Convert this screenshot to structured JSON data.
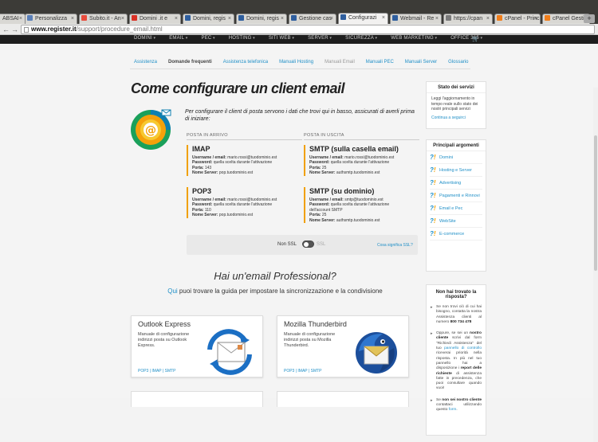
{
  "browser": {
    "tabs": [
      {
        "label": "ABSAI",
        "color": "#2b5fb0"
      },
      {
        "label": "Personalizza",
        "color": "#5a7fb8"
      },
      {
        "label": "Subito.it - An",
        "color": "#e84b3c"
      },
      {
        "label": "Domini .it e",
        "color": "#d93025"
      },
      {
        "label": "Domini, regis",
        "color": "#2e5e9e"
      },
      {
        "label": "Domini, regis",
        "color": "#2e5e9e"
      },
      {
        "label": "Gestione cas",
        "color": "#2e5e9e"
      },
      {
        "label": "Configurazi",
        "color": "#2e5e9e"
      },
      {
        "label": "Webmail - Re",
        "color": "#2e5e9e"
      },
      {
        "label": "https://cpan",
        "color": "#7a7a7a"
      },
      {
        "label": "cPanel - Princ",
        "color": "#f07e1b"
      },
      {
        "label": "cPanel Gesti",
        "color": "#f07e1b"
      }
    ],
    "active_tab": 7,
    "url_host": "www.register.it",
    "url_path": "/support/procedure_email.html"
  },
  "topnav": [
    "DOMINI",
    "EMAIL",
    "PEC",
    "HOSTING",
    "SITI WEB",
    "SERVER",
    "SICUREZZA",
    "WEB MARKETING",
    "OFFICE 365"
  ],
  "subnav": [
    {
      "label": "Assistenza",
      "state": "link"
    },
    {
      "label": "Domande frequenti",
      "state": "current"
    },
    {
      "label": "Assistenza telefonica",
      "state": "link"
    },
    {
      "label": "Manuali Hosting",
      "state": "link"
    },
    {
      "label": "Manuali Email",
      "state": "disabled"
    },
    {
      "label": "Manuali PEC",
      "state": "link"
    },
    {
      "label": "Manuali Server",
      "state": "link"
    },
    {
      "label": "Glossario",
      "state": "link"
    }
  ],
  "main": {
    "title": "Come configurare un client email",
    "intro": "Per configurare il client di posta servono i dati che trovi qui in basso, assicurati di averli prima di iniziare:",
    "col_in": "POSTA IN ARRIVO",
    "col_out": "POSTA IN USCITA",
    "servers": {
      "imap": {
        "title": "IMAP",
        "l1k": "Username / email:",
        "l1v": "mario.rossi@tuodominio.est",
        "l2k": "Password:",
        "l2v": "quella scelta durante l'attivazione",
        "l3k": "Porta:",
        "l3v": "143",
        "l4k": "Nome Server:",
        "l4v": "pop.tuodominio.est"
      },
      "pop3": {
        "title": "POP3",
        "l1k": "Username / email:",
        "l1v": "mario.rossi@tuodominio.est",
        "l2k": "Password:",
        "l2v": "quella scelta durante l'attivazione",
        "l3k": "Porta:",
        "l3v": "110",
        "l4k": "Nome Server:",
        "l4v": "pop.tuodominio.est"
      },
      "smtp1": {
        "title": "SMTP (sulla casella email)",
        "l1k": "Username / email:",
        "l1v": "mario.rossi@tuodominio.est",
        "l2k": "Password:",
        "l2v": "quella scelta durante l'attivazione",
        "l3k": "Porta:",
        "l3v": "25",
        "l4k": "Nome Server:",
        "l4v": "authsmtp.tuodominio.est"
      },
      "smtp2": {
        "title": "SMTP (su dominio)",
        "l1k": "Username / email:",
        "l1v": "smtp@tuodominio.est",
        "l2k": "Password:",
        "l2v": "quella scelta durante l'attivazione",
        "l2b": "dell'account SMTP",
        "l3k": "Porta:",
        "l3v": "25",
        "l4k": "Nome Server:",
        "l4v": "authsmtp.tuodominio.est"
      }
    },
    "ssl": {
      "off": "Non SSL",
      "on": "SSL",
      "link": "Cosa significa SSL?"
    },
    "pro_title": "Hai un'email Professional?",
    "pro_sub_link": "Qui",
    "pro_sub_rest": " puoi trovare la guida per impostare la sincronizzazione e la condivisione",
    "cards": [
      {
        "title": "Outlook Express",
        "desc": "Manuale di configurazione indirizzi posta su Outlook Express.",
        "links": "POP3 | IMAP | SMTP"
      },
      {
        "title": "Mozilla Thunderbird",
        "desc": "Manuale di configurazione indirizzi posta su Mozilla Thunderbird.",
        "links": "POP3 | IMAP | SMTP"
      }
    ]
  },
  "sidebar": {
    "status_title": "Stato dei servizi",
    "status_text": "Leggi l'aggiornamento in tempo reale sullo stato dei nostri principali servizi",
    "status_link": "Continua a seguirci",
    "topics_title": "Principali argomenti",
    "topics": [
      "Domini",
      "Hosting e Server",
      "Advertising",
      "Pagamenti e Rinnovi",
      "Email e Pec",
      "WebSite",
      "E-commerce"
    ],
    "notfound_title": "Non hai trovato la risposta?",
    "nf1": "Se non trovi ciò di cui hai bisogno, contatta la nostra Assistenza clienti al numero",
    "nf1_phone": "800 734 478",
    "nf2a": "Oppure, se sei un",
    "nf2b": "nostro cliente",
    "nf2c": "scrivi dal form \"Richiedi Assistenza\" del tuo",
    "nf2d": "pannello di controllo",
    "nf2e": "riceverai priorità nella risposta. In più nel tuo pannello hai a disposizione i",
    "nf2f": "report delle richieste",
    "nf2g": "di assistenza fatte in precedenza, che puoi consultare quando vuoi!",
    "nf3a": "Se",
    "nf3b": "non sei nostro cliente",
    "nf3c": "contattaci utilizzando questo",
    "nf3d": "form"
  }
}
